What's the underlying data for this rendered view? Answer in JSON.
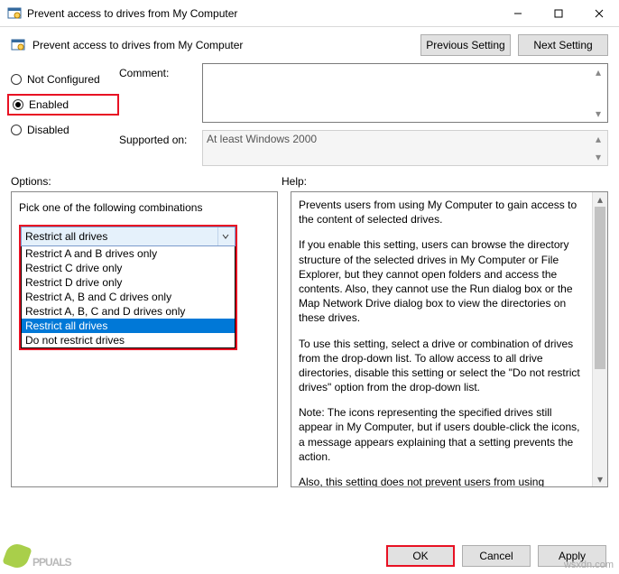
{
  "window": {
    "title": "Prevent access to drives from My Computer"
  },
  "header": {
    "policy_name": "Prevent access to drives from My Computer",
    "prev_btn": "Previous Setting",
    "next_btn": "Next Setting"
  },
  "state": {
    "not_configured": "Not Configured",
    "enabled": "Enabled",
    "disabled": "Disabled",
    "selected": "enabled"
  },
  "fields": {
    "comment_label": "Comment:",
    "comment_value": "",
    "supported_label": "Supported on:",
    "supported_value": "At least Windows 2000"
  },
  "labels": {
    "options": "Options:",
    "help": "Help:"
  },
  "options": {
    "title": "Pick one of the following combinations",
    "selected": "Restrict all drives",
    "items": [
      "Restrict A and B drives only",
      "Restrict C drive only",
      "Restrict D drive only",
      "Restrict A, B and C drives only",
      "Restrict A, B, C and D drives only",
      "Restrict all drives",
      "Do not restrict drives"
    ]
  },
  "help": {
    "p1": "Prevents users from using My Computer to gain access to the content of selected drives.",
    "p2": "If you enable this setting, users can browse the directory structure of the selected drives in My Computer or File Explorer, but they cannot open folders and access the contents. Also, they cannot use the Run dialog box or the Map Network Drive dialog box to view the directories on these drives.",
    "p3": "To use this setting, select a drive or combination of drives from the drop-down list. To allow access to all drive directories, disable this setting or select the \"Do not restrict drives\" option from the drop-down list.",
    "p4": "Note: The icons representing the specified drives still appear in My Computer, but if users double-click the icons, a message appears explaining that a setting prevents the action.",
    "p5": " Also, this setting does not prevent users from using programs to access local and network drives. And, it does not prevent them from using the Disk Management snap-in to view and change"
  },
  "buttons": {
    "ok": "OK",
    "cancel": "Cancel",
    "apply": "Apply"
  },
  "watermark": {
    "left": "PPUALS",
    "right": "wsxdn.com"
  }
}
